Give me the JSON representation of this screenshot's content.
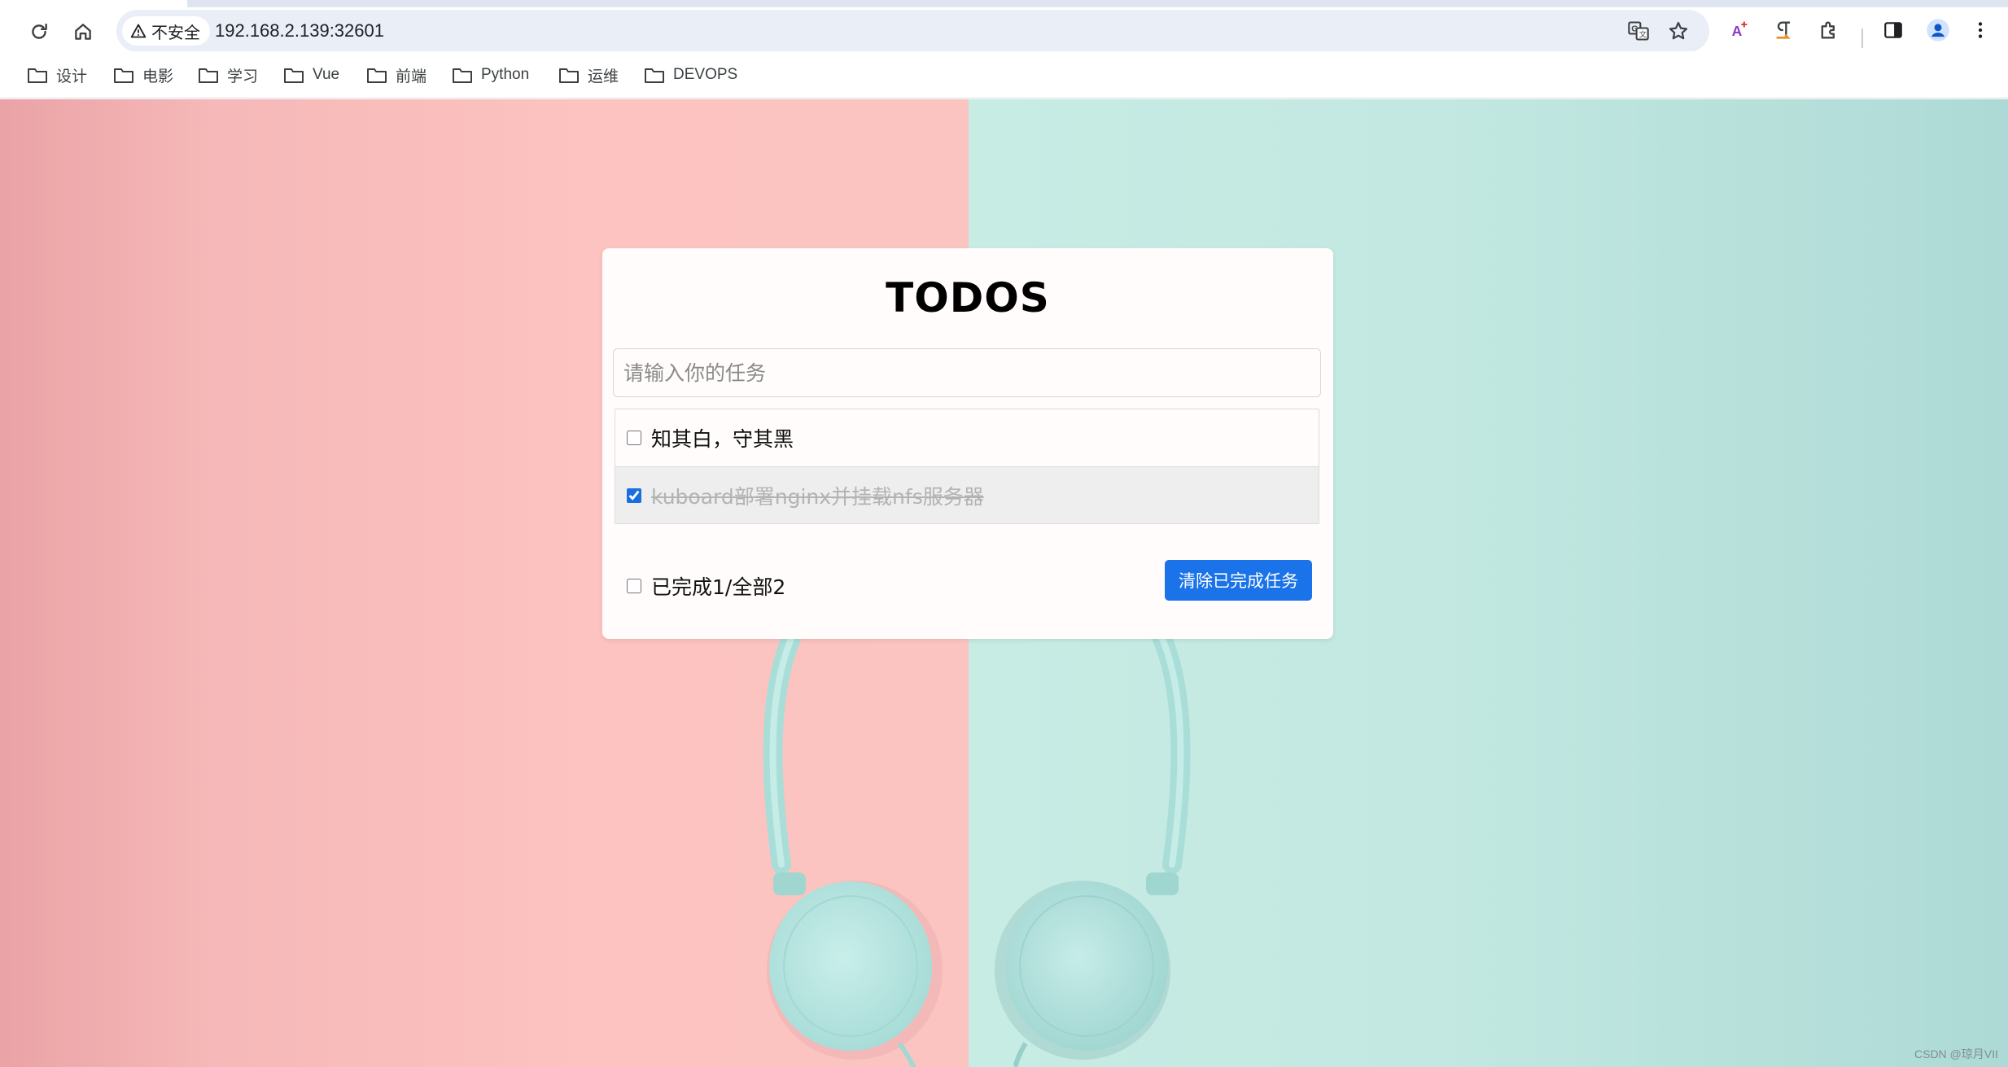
{
  "browser": {
    "security_label": "不安全",
    "url": "192.168.2.139:32601",
    "icons": [
      "reload-icon",
      "home-icon",
      "warning-icon",
      "translate-icon",
      "star-icon",
      "extension-puzzle-icon",
      "sidebar-icon",
      "profile-icon",
      "menu-icon"
    ]
  },
  "bookmarks": [
    {
      "label": "设计"
    },
    {
      "label": "电影"
    },
    {
      "label": "学习"
    },
    {
      "label": "Vue"
    },
    {
      "label": "前端"
    },
    {
      "label": "Python"
    },
    {
      "label": "运维"
    },
    {
      "label": "DEVOPS"
    }
  ],
  "todo": {
    "title": "TODOS",
    "input_placeholder": "请输入你的任务",
    "items": [
      {
        "text": "知其白，守其黑",
        "done": false
      },
      {
        "text": "kuboard部署nginx并挂载nfs服务器",
        "done": true
      }
    ],
    "footer_label": "已完成1/全部2",
    "completed_count": 1,
    "total_count": 2,
    "clear_button": "清除已完成任务"
  },
  "colors": {
    "accent": "#1a73e8",
    "bg_left": "#fcc3c0",
    "bg_right": "#c2e8e1"
  },
  "watermark": "CSDN @琼月VII"
}
